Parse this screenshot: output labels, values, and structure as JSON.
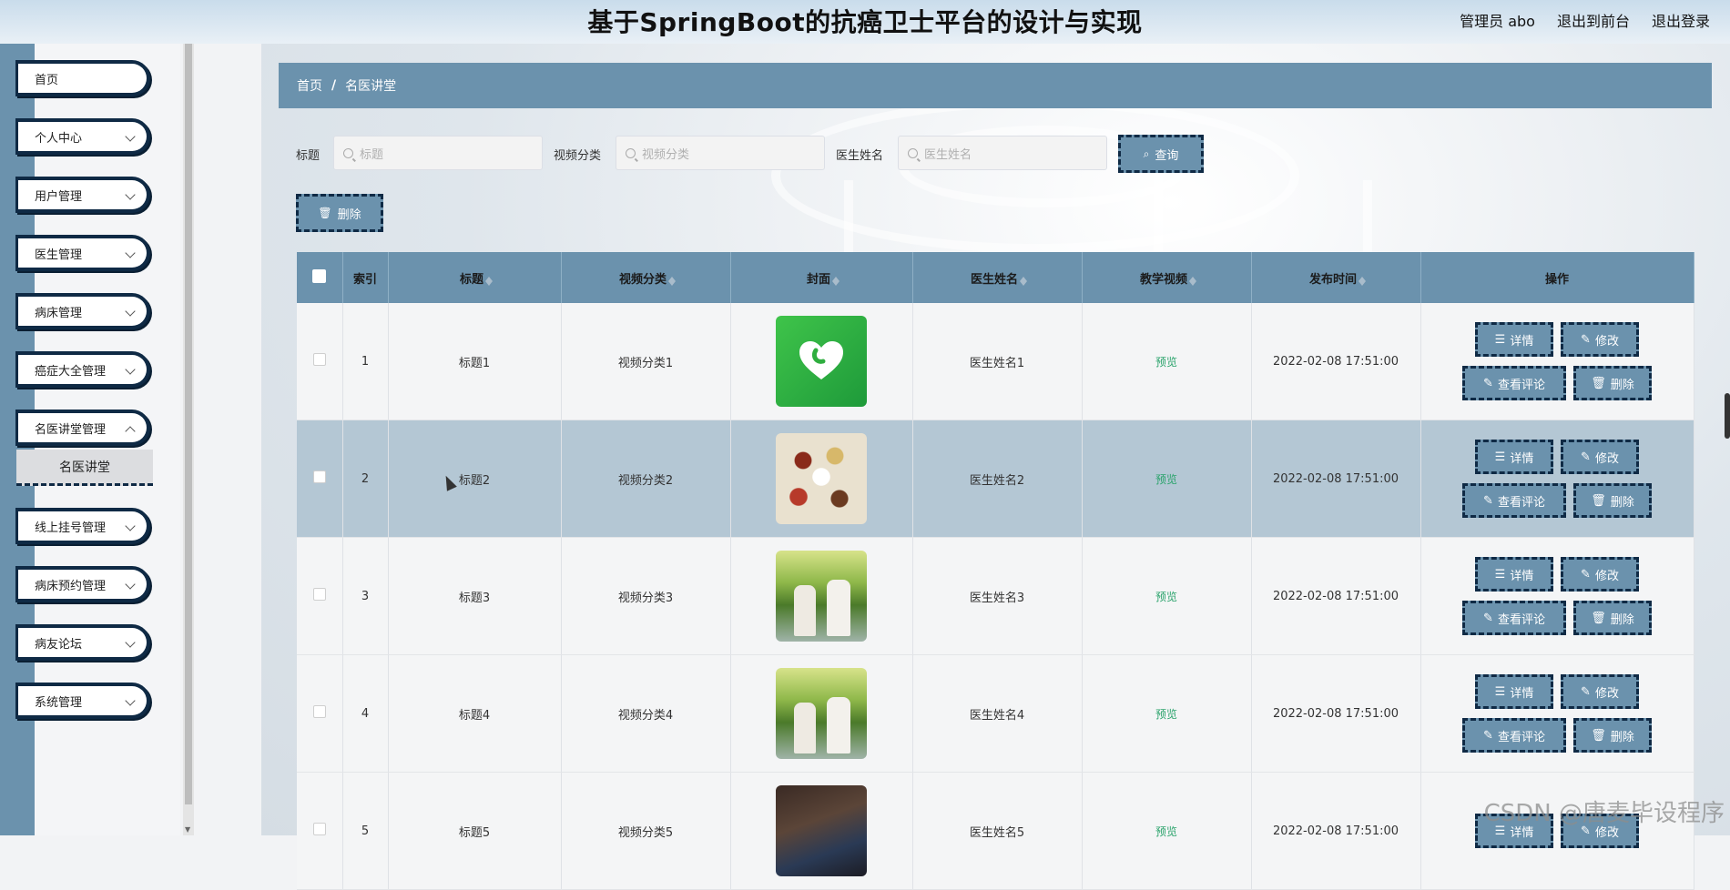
{
  "header": {
    "title": "基于SpringBoot的抗癌卫士平台的设计与实现",
    "user": "管理员 abo",
    "exit_front": "退出到前台",
    "logout": "退出登录"
  },
  "sidebar": {
    "items": [
      {
        "label": "首页"
      },
      {
        "label": "个人中心"
      },
      {
        "label": "用户管理"
      },
      {
        "label": "医生管理"
      },
      {
        "label": "病床管理"
      },
      {
        "label": "癌症大全管理"
      },
      {
        "label": "名医讲堂管理"
      },
      {
        "label": "线上挂号管理"
      },
      {
        "label": "病床预约管理"
      },
      {
        "label": "病友论坛"
      },
      {
        "label": "系统管理"
      }
    ],
    "active_sub": "名医讲堂"
  },
  "breadcrumb": {
    "home": "首页",
    "sep": "/",
    "current": "名医讲堂"
  },
  "search": {
    "title_label": "标题",
    "title_placeholder": "标题",
    "category_label": "视频分类",
    "category_placeholder": "视频分类",
    "doctor_label": "医生姓名",
    "doctor_placeholder": "医生姓名",
    "query_button": "查询"
  },
  "toolbar": {
    "delete_label": "删除"
  },
  "table": {
    "columns": {
      "index": "索引",
      "title": "标题",
      "category": "视频分类",
      "cover": "封面",
      "doctor": "医生姓名",
      "video": "教学视频",
      "time": "发布时间",
      "ops": "操作"
    },
    "rows": [
      {
        "index": "1",
        "title": "标题1",
        "category": "视频分类1",
        "cover": "app-logo",
        "doctor": "医生姓名1",
        "video": "预览",
        "time": "2022-02-08 17:51:00"
      },
      {
        "index": "2",
        "title": "标题2",
        "category": "视频分类2",
        "cover": "food-photo",
        "doctor": "医生姓名2",
        "video": "预览",
        "time": "2022-02-08 17:51:00"
      },
      {
        "index": "3",
        "title": "标题3",
        "category": "视频分类3",
        "cover": "park-photo",
        "doctor": "医生姓名3",
        "video": "预览",
        "time": "2022-02-08 17:51:00"
      },
      {
        "index": "4",
        "title": "标题4",
        "category": "视频分类4",
        "cover": "park-photo",
        "doctor": "医生姓名4",
        "video": "预览",
        "time": "2022-02-08 17:51:00"
      },
      {
        "index": "5",
        "title": "标题5",
        "category": "视频分类5",
        "cover": "dark-photo",
        "doctor": "医生姓名5",
        "video": "预览",
        "time": "2022-02-08 17:51:00"
      }
    ],
    "op_labels": {
      "detail": "详情",
      "edit": "修改",
      "comments": "查看评论",
      "delete": "删除"
    }
  },
  "watermark": "CSDN @唐麦毕设程序",
  "colors": {
    "accent": "#6b92ad",
    "border": "#0f2a45",
    "link": "#2aa36b"
  }
}
